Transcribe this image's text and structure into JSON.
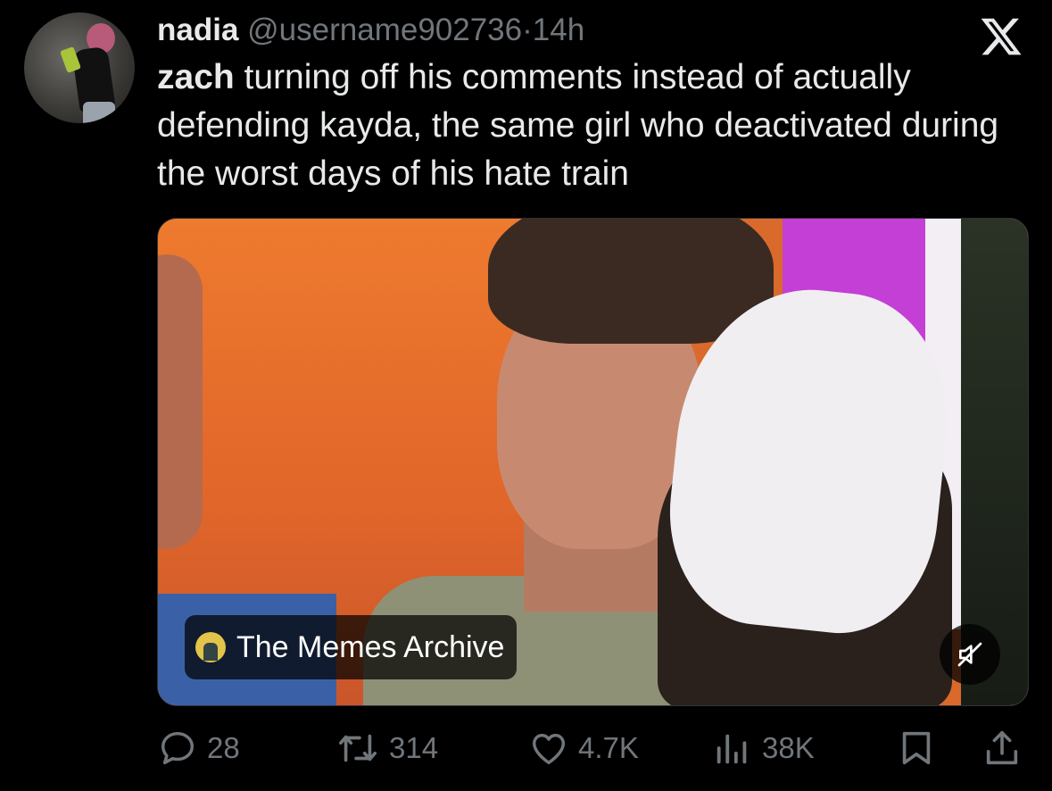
{
  "tweet": {
    "author_name": "nadia",
    "author_handle": "@username902736",
    "separator": "·",
    "time": "14h",
    "mention": "zach",
    "text": " turning off his comments instead of actually defending kayda, the same girl who deactivated during the worst days of his hate train"
  },
  "media": {
    "source_label": "The Memes Archive",
    "source_icon": "memes-archive-avatar",
    "mute_icon": "muted-speaker-icon"
  },
  "actions": {
    "replies": "28",
    "retweets": "314",
    "likes": "4.7K",
    "views": "38K"
  },
  "icons": {
    "brand": "x-logo",
    "reply": "reply-icon",
    "retweet": "retweet-icon",
    "like": "heart-icon",
    "views": "views-bar-icon",
    "bookmark": "bookmark-icon",
    "share": "share-icon"
  },
  "colors": {
    "background": "#000000",
    "text_primary": "#e7e9ea",
    "text_secondary": "#71767b"
  }
}
